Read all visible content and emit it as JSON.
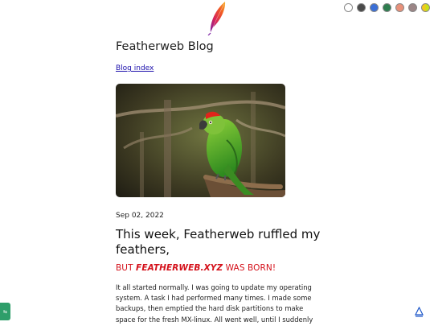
{
  "header": {
    "logo_icon": "feather-icon",
    "theme_swatches": [
      {
        "name": "swatch-white",
        "color": "#ffffff"
      },
      {
        "name": "swatch-dark",
        "color": "#4a4a4a"
      },
      {
        "name": "swatch-blue",
        "color": "#3b6fd6"
      },
      {
        "name": "swatch-green",
        "color": "#2e7d4f"
      },
      {
        "name": "swatch-salmon",
        "color": "#e8917a"
      },
      {
        "name": "swatch-mauve",
        "color": "#9b8586"
      },
      {
        "name": "swatch-lime-yellow",
        "color": "#c7e21a"
      }
    ]
  },
  "blog": {
    "title": "Featherweb Blog",
    "index_link": "Blog index"
  },
  "post": {
    "image_alt": "Green parrot perched on a branch",
    "date": "Sep 02, 2022",
    "title": "This week, Featherweb ruffled my feathers,",
    "subtitle_prefix": "BUT ",
    "subtitle_brand": "FEATHERWEB.XYZ",
    "subtitle_suffix": " WAS BORN!",
    "body": "It all started normally. I was going to update my operating system. A task I had performed many times. I made some backups, then emptied the hard disk partitions to make space for the fresh MX-linux. All went well, until I suddenly realized I had also wiped my password manager."
  },
  "widgets": {
    "left_tab_label": "⇆",
    "accessibility_icon": "accessibility-icon"
  }
}
